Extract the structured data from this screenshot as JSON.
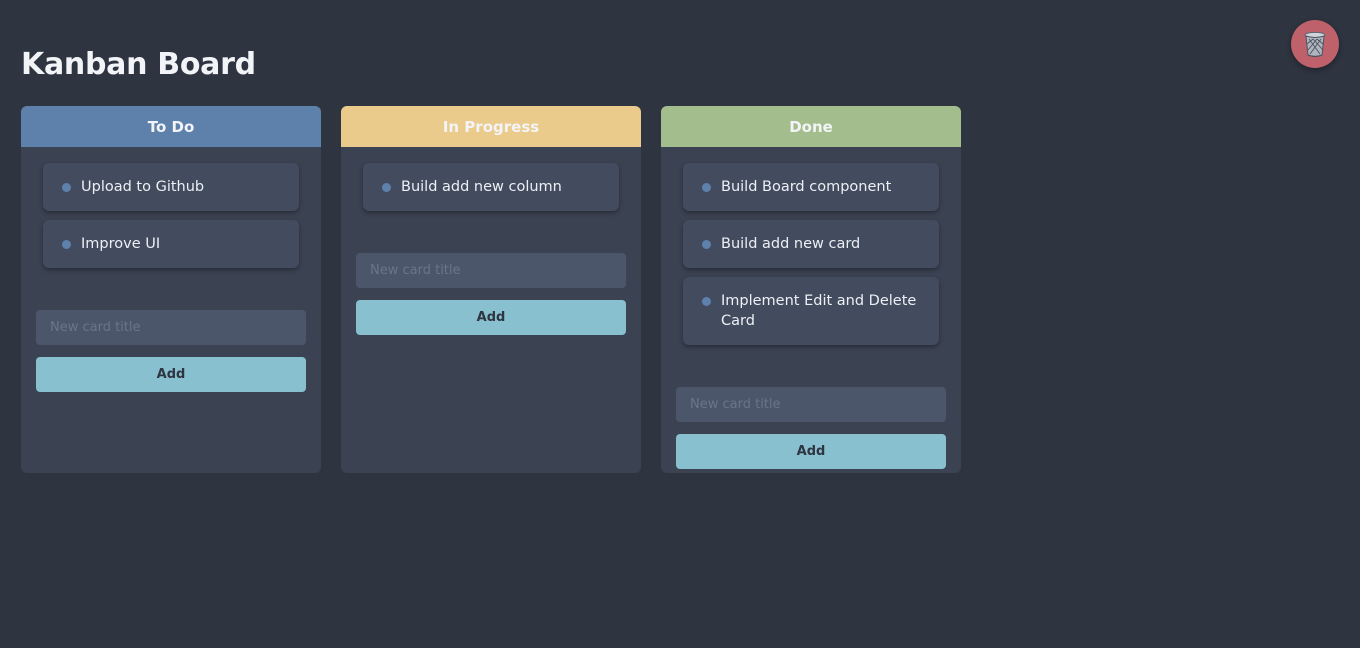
{
  "page": {
    "title": "Kanban Board"
  },
  "trash": {
    "icon": "trash-can-icon",
    "color": "#bf616a"
  },
  "columns": [
    {
      "title": "To Do",
      "color": "#5e81ac",
      "cards": [
        "Upload to Github",
        "Improve UI"
      ],
      "input_placeholder": "New card title",
      "add_label": "Add"
    },
    {
      "title": "In Progress",
      "color": "#ebcb8b",
      "cards": [
        "Build add new column"
      ],
      "input_placeholder": "New card title",
      "add_label": "Add"
    },
    {
      "title": "Done",
      "color": "#a3be8c",
      "cards": [
        "Build Board component",
        "Build add new card",
        "Implement Edit and Delete Card"
      ],
      "input_placeholder": "New card title",
      "add_label": "Add"
    }
  ]
}
